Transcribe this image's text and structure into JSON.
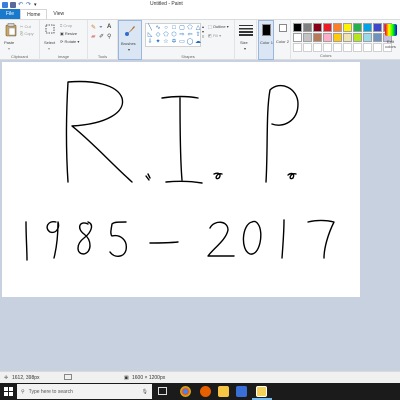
{
  "window": {
    "title": "Untitled - Paint"
  },
  "tabs": [
    {
      "label": "File"
    },
    {
      "label": "Home"
    },
    {
      "label": "View"
    }
  ],
  "ribbon": {
    "clipboard": {
      "paste": "Paste",
      "cut": "Cut",
      "copy": "Copy",
      "group": "Clipboard"
    },
    "image": {
      "select": "Select",
      "crop": "Crop",
      "resize": "Resize",
      "rotate": "Rotate",
      "group": "Image"
    },
    "tools": {
      "group": "Tools"
    },
    "brushes": {
      "label": "Brushes"
    },
    "shapes": {
      "outline": "Outline",
      "fill": "Fill",
      "group": "Shapes"
    },
    "size": {
      "label": "Size"
    },
    "color1": {
      "label": "Color 1"
    },
    "color2": {
      "label": "Color 2"
    },
    "colors": {
      "group": "Colors",
      "edit": "Edit colors"
    }
  },
  "palette": [
    "#000000",
    "#7f7f7f",
    "#880015",
    "#ed1c24",
    "#ff7f27",
    "#fff200",
    "#22b14c",
    "#00a2e8",
    "#3f48cc",
    "#a349a4",
    "#ffffff",
    "#c3c3c3",
    "#b97a57",
    "#ffaec9",
    "#ffc90e",
    "#efe4b0",
    "#b5e61d",
    "#99d9ea",
    "#7092be",
    "#c8bfe7",
    "#ffffff",
    "#ffffff",
    "#ffffff",
    "#ffffff",
    "#ffffff",
    "#ffffff",
    "#ffffff",
    "#ffffff",
    "#ffffff",
    "#ffffff"
  ],
  "status": {
    "cursor": "1612, 398px",
    "dimensions": "1600 × 1200px"
  },
  "taskbar": {
    "search_placeholder": "Type here to search"
  }
}
